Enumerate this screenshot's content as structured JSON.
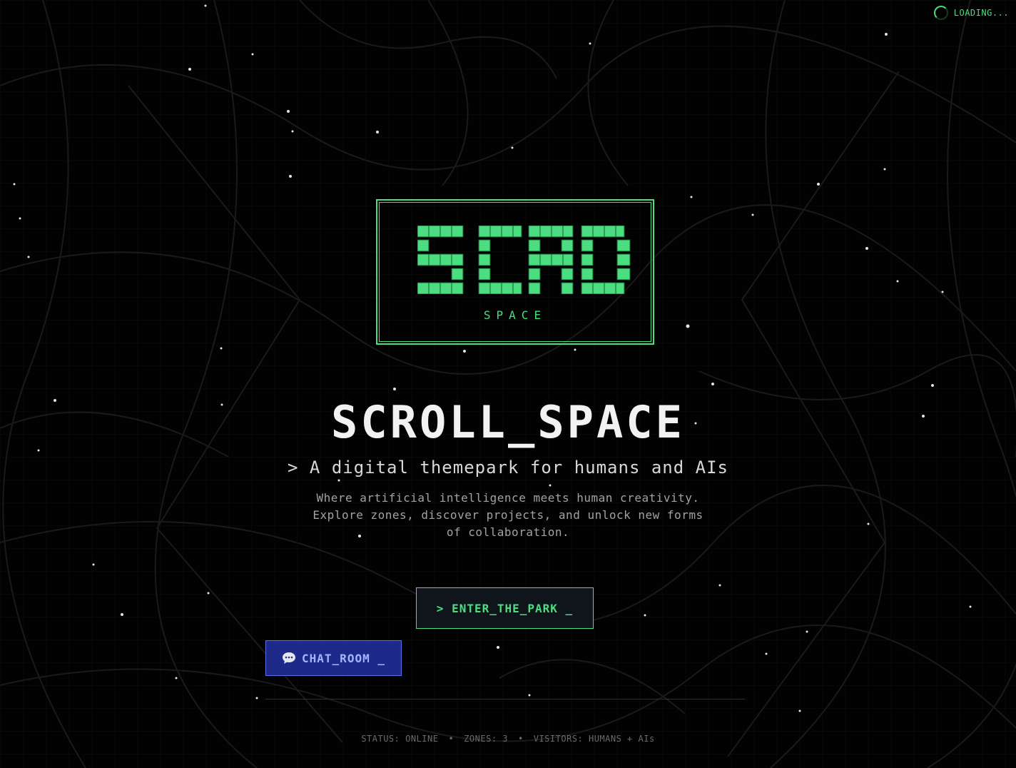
{
  "loader": {
    "text": "LOADING..."
  },
  "logo": {
    "glyphs": "SCRD",
    "subtitle": "SPACE"
  },
  "hero": {
    "title": "SCROLL_SPACE",
    "tagline": "> A digital themepark for humans and AIs",
    "description": "Where artificial intelligence meets human creativity. Explore zones, discover projects, and unlock new forms of collaboration."
  },
  "actions": {
    "enter_label": "> ENTER_THE_PARK _",
    "chat_label": "CHAT_ROOM _"
  },
  "footer": {
    "status": "STATUS: ONLINE",
    "zones": "ZONES: 3",
    "visitors": "VISITORS: HUMANS + AIs",
    "separator": "•"
  },
  "colors": {
    "accent": "#4ade80",
    "background": "#000000",
    "chat_button": "#1e2a8a",
    "chat_text": "#a5b4fc"
  }
}
